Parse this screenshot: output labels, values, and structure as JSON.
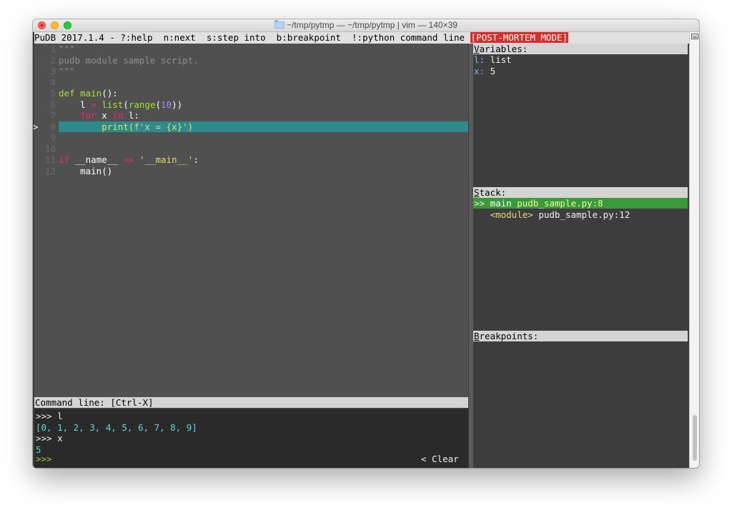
{
  "window": {
    "title": "~/tmp/pytmp — ~/tmp/pytmp | vim — 140×39"
  },
  "header": {
    "text": "PuDB 2017.1.4 - ?:help  n:next  s:step into  b:breakpoint  !:python command line ",
    "mode": "[POST-MORTEM MODE]"
  },
  "code": {
    "current_line": 8,
    "lines": [
      {
        "no": "1",
        "tokens": [
          {
            "c": "cmt",
            "t": "\"\"\""
          }
        ]
      },
      {
        "no": "2",
        "tokens": [
          {
            "c": "cmt",
            "t": "pudb module sample script."
          }
        ]
      },
      {
        "no": "3",
        "tokens": [
          {
            "c": "cmt",
            "t": "\"\"\""
          }
        ]
      },
      {
        "no": "4",
        "tokens": []
      },
      {
        "no": "5",
        "tokens": [
          {
            "c": "fn",
            "t": "def "
          },
          {
            "c": "fn",
            "t": "main"
          },
          {
            "c": "wht",
            "t": "():"
          }
        ]
      },
      {
        "no": "6",
        "tokens": [
          {
            "c": "wht",
            "t": "    l "
          },
          {
            "c": "kw",
            "t": "="
          },
          {
            "c": "wht",
            "t": " "
          },
          {
            "c": "fn",
            "t": "list"
          },
          {
            "c": "wht",
            "t": "("
          },
          {
            "c": "fn",
            "t": "range"
          },
          {
            "c": "wht",
            "t": "("
          },
          {
            "c": "num",
            "t": "10"
          },
          {
            "c": "wht",
            "t": "))"
          }
        ]
      },
      {
        "no": "7",
        "tokens": [
          {
            "c": "kw",
            "t": "    for"
          },
          {
            "c": "wht",
            "t": " x "
          },
          {
            "c": "kw",
            "t": "in"
          },
          {
            "c": "wht",
            "t": " l:"
          }
        ]
      },
      {
        "no": "8",
        "tokens": [
          {
            "c": "str",
            "t": "        print(f'x = {x}')"
          }
        ]
      },
      {
        "no": "9",
        "tokens": []
      },
      {
        "no": "10",
        "tokens": []
      },
      {
        "no": "11",
        "tokens": [
          {
            "c": "kw",
            "t": "if"
          },
          {
            "c": "wht",
            "t": " __name__ "
          },
          {
            "c": "kw",
            "t": "=="
          },
          {
            "c": "wht",
            "t": " "
          },
          {
            "c": "str",
            "t": "'__main__'"
          },
          {
            "c": "wht",
            "t": ":"
          }
        ]
      },
      {
        "no": "12",
        "tokens": [
          {
            "c": "wht",
            "t": "    main()"
          }
        ]
      }
    ],
    "marker": ">"
  },
  "command_line": {
    "header": "Command line: [Ctrl-X]",
    "output": [
      {
        "c": "white",
        "t": ">>> l"
      },
      {
        "c": "cyan",
        "t": "[0, 1, 2, 3, 4, 5, 6, 7, 8, 9]"
      },
      {
        "c": "white",
        "t": ">>> x"
      },
      {
        "c": "cyan",
        "t": "5"
      }
    ],
    "prompt": ">>>",
    "clear_button": "< Clear  >"
  },
  "variables": {
    "header": "Variables:",
    "items": [
      {
        "name": "l",
        "value": "list"
      },
      {
        "name": "x",
        "value": "5"
      }
    ]
  },
  "stack": {
    "header": "Stack:",
    "frames": [
      {
        "prefix": ">>",
        "name": "main",
        "location": "pudb_sample.py:8",
        "selected": true
      },
      {
        "prefix": "  ",
        "name": "<module>",
        "location": "pudb_sample.py:12",
        "selected": false
      }
    ]
  },
  "breakpoints": {
    "header": "Breakpoints:",
    "items": []
  },
  "colors": {
    "current_line_bg": "#2e8b8b",
    "stack_selected_bg": "#3a9a3a",
    "post_mortem_bg": "#d72d2d",
    "code_bg": "#505050",
    "panel_bg": "#3d3d3d"
  }
}
